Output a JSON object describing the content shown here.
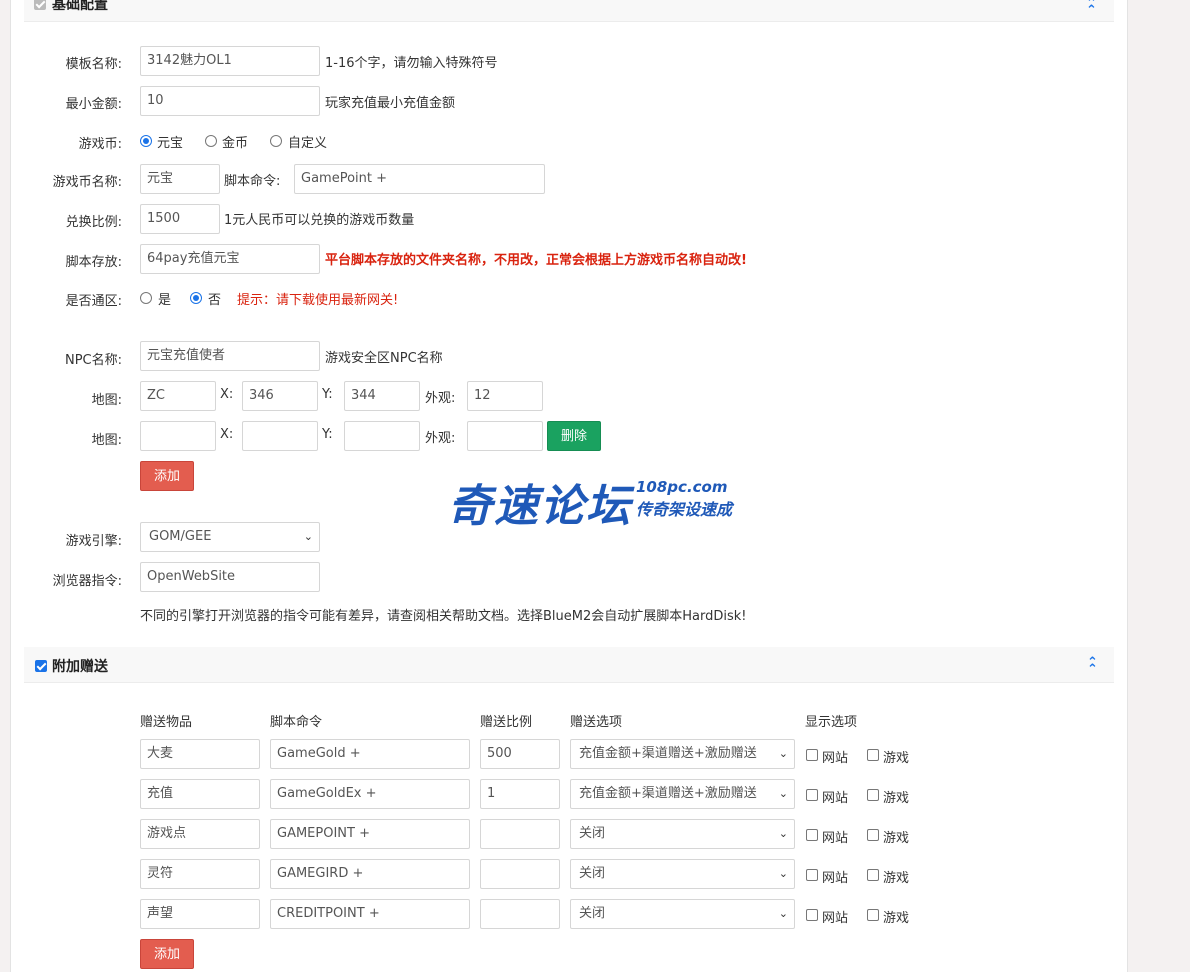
{
  "basic": {
    "title": "基础配置",
    "template_name_label": "模板名称:",
    "template_name_value": "3142魅力OL1",
    "template_name_hint": "1-16个字，请勿输入特殊符号",
    "min_amount_label": "最小金额:",
    "min_amount_value": "10",
    "min_amount_hint": "玩家充值最小充值金额",
    "currency_label": "游戏币:",
    "currency_options": [
      "元宝",
      "金币",
      "自定义"
    ],
    "currency_selected": "元宝",
    "currency_name_label": "游戏币名称:",
    "currency_name_value": "元宝",
    "script_cmd_label": "脚本命令:",
    "script_cmd_value": "GamePoint +",
    "ratio_label": "兑换比例:",
    "ratio_value": "1500",
    "ratio_hint": "1元人民币可以兑换的游戏币数量",
    "script_dir_label": "脚本存放:",
    "script_dir_value": "64pay充值元宝",
    "script_dir_hint": "平台脚本存放的文件夹名称，不用改，正常会根据上方游戏币名称自动改!",
    "universal_label": "是否通区:",
    "universal_yes": "是",
    "universal_no": "否",
    "universal_selected": "否",
    "universal_tip": "提示：请下载使用最新网关!",
    "npc_label": "NPC名称:",
    "npc_value": "元宝充值使者",
    "npc_hint": "游戏安全区NPC名称",
    "maps": [
      {
        "label": "地图:",
        "map": "ZC",
        "x_label": "X:",
        "x": "346",
        "y_label": "Y:",
        "y": "344",
        "look_label": "外观:",
        "look": "12"
      },
      {
        "label": "地图:",
        "map": "",
        "x_label": "X:",
        "x": "",
        "y_label": "Y:",
        "y": "",
        "look_label": "外观:",
        "look": "",
        "delete_label": "删除"
      }
    ],
    "add_label": "添加",
    "engine_label": "游戏引擎:",
    "engine_value": "GOM/GEE",
    "browser_cmd_label": "浏览器指令:",
    "browser_cmd_value": "OpenWebSite",
    "browser_note": "不同的引擎打开浏览器的指令可能有差异，请查阅相关帮助文档。选择BlueM2会自动扩展脚本HardDisk!"
  },
  "gift": {
    "title": "附加赠送",
    "checked": true,
    "headers": [
      "赠送物品",
      "脚本命令",
      "赠送比例",
      "赠送选项",
      "显示选项"
    ],
    "rows": [
      {
        "item": "大麦",
        "cmd": "GameGold  +",
        "ratio": "500",
        "option": "充值金额+渠道赠送+激励赠送"
      },
      {
        "item": "充值",
        "cmd": "GameGoldEx   +",
        "ratio": "1",
        "option": "充值金额+渠道赠送+激励赠送"
      },
      {
        "item": "游戏点",
        "cmd": "GAMEPOINT +",
        "ratio": "",
        "option": "关闭"
      },
      {
        "item": "灵符",
        "cmd": "GAMEGIRD +",
        "ratio": "",
        "option": "关闭"
      },
      {
        "item": "声望",
        "cmd": "CREDITPOINT +",
        "ratio": "",
        "option": "关闭"
      }
    ],
    "show_web": "网站",
    "show_game": "游戏",
    "add_label": "添加"
  },
  "watermark": {
    "main": "奇速论坛",
    "url": "108pc.com",
    "sub": "传奇架设速成"
  },
  "colors": {
    "accent": "#1a73e8",
    "danger": "#e35d4f",
    "success": "#1aa260",
    "warning_text": "#d9230f"
  }
}
